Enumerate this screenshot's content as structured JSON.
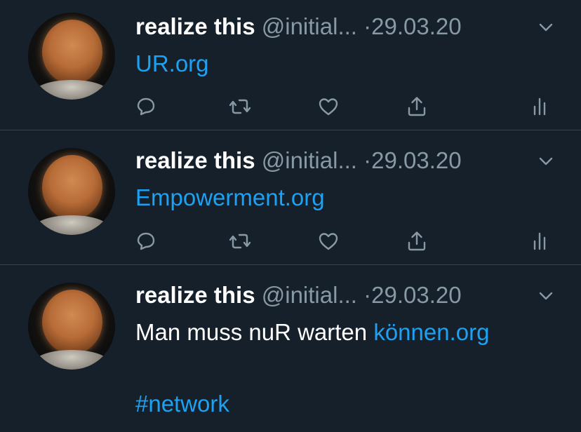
{
  "tweets": [
    {
      "name": "realize this",
      "handle": "@initial...",
      "date": "·29.03.20",
      "text_plain": "",
      "text_link": "UR.org"
    },
    {
      "name": "realize this",
      "handle": "@initial...",
      "date": "·29.03.20",
      "text_plain": "",
      "text_link": "Empowerment.org"
    },
    {
      "name": "realize this",
      "handle": "@initial...",
      "date": "·29.03.20",
      "text_plain": "Man muss nuR warten ",
      "text_link": "können.org",
      "hashtag": "#network"
    }
  ],
  "icons": {
    "reply": "reply-icon",
    "retweet": "retweet-icon",
    "like": "heart-icon",
    "share": "share-icon",
    "stats": "analytics-icon",
    "caret": "chevron-down-icon"
  },
  "colors": {
    "background": "#15202b",
    "divider": "#38444d",
    "secondary_text": "#8899a6",
    "link": "#1da1f2",
    "primary_text": "#ffffff"
  }
}
